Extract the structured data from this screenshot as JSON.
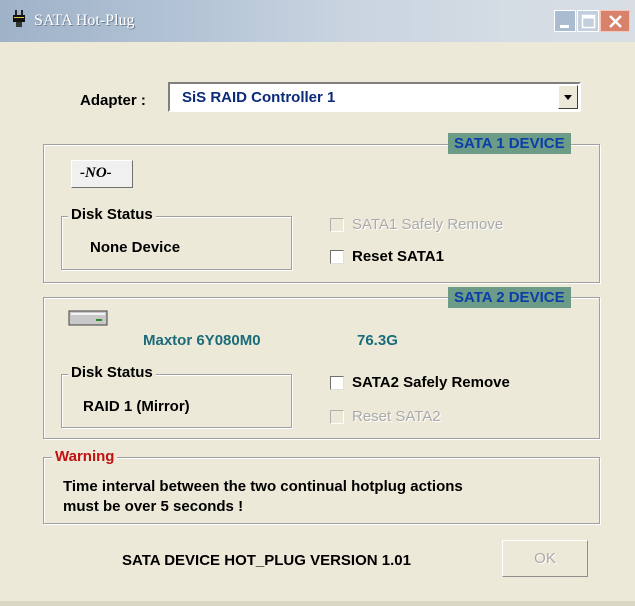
{
  "window": {
    "title": "SATA Hot-Plug"
  },
  "icons": {
    "app": "plug-icon",
    "minimize": "minimize-icon",
    "maximize": "maximize-icon",
    "close": "close-icon",
    "no_device": "no-device-icon",
    "drive": "hard-drive-icon",
    "dropdown": "chevron-down-icon"
  },
  "adapter": {
    "label": "Adapter :",
    "value": "SiS RAID Controller  1"
  },
  "sata1": {
    "title": "SATA 1 DEVICE",
    "no_device_text": "-NO-",
    "disk_status_label": "Disk Status",
    "disk_status_value": "None Device",
    "safely_remove_label": "SATA1 Safely Remove",
    "safely_remove_enabled": false,
    "safely_remove_checked": false,
    "reset_label": "Reset SATA1",
    "reset_enabled": true,
    "reset_checked": false
  },
  "sata2": {
    "title": "SATA 2 DEVICE",
    "model": "Maxtor 6Y080M0",
    "capacity": "76.3G",
    "disk_status_label": "Disk Status",
    "disk_status_value": "RAID 1 (Mirror)",
    "safely_remove_label": "SATA2 Safely Remove",
    "safely_remove_enabled": true,
    "safely_remove_checked": false,
    "reset_label": "Reset SATA2",
    "reset_enabled": false,
    "reset_checked": false
  },
  "warning": {
    "title": "Warning",
    "line1": "Time interval between the two continual hotplug actions",
    "line2": "must be over 5 seconds !"
  },
  "footer": {
    "version": "SATA DEVICE HOT_PLUG VERSION 1.01",
    "ok_label": "OK",
    "ok_enabled": false
  },
  "colors": {
    "badge_bg": "#6c9b88",
    "badge_text": "#0b3ea8",
    "warning_text": "#c01010",
    "device_text": "#1b6b7a"
  }
}
